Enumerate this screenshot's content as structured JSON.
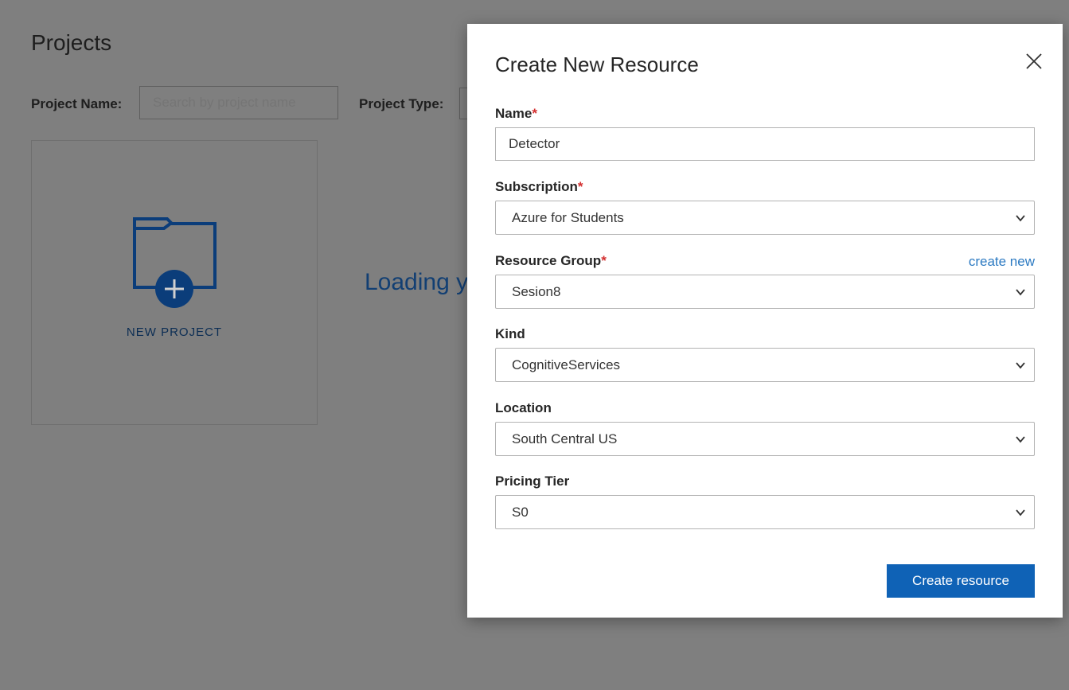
{
  "background": {
    "page_title": "Projects",
    "filters": {
      "project_name_label": "Project Name:",
      "search_placeholder": "Search by project name",
      "project_type_label": "Project Type:"
    },
    "new_project_label": "NEW PROJECT",
    "loading_text": "Loading your projects..."
  },
  "modal": {
    "title": "Create New Resource",
    "fields": {
      "name": {
        "label": "Name",
        "required_mark": "*",
        "value": "Detector"
      },
      "subscription": {
        "label": "Subscription",
        "required_mark": "*",
        "value": "Azure for Students"
      },
      "resource_group": {
        "label": "Resource Group",
        "required_mark": "*",
        "value": "Sesion8",
        "create_new_label": "create new"
      },
      "kind": {
        "label": "Kind",
        "value": "CognitiveServices"
      },
      "location": {
        "label": "Location",
        "value": "South Central US"
      },
      "pricing_tier": {
        "label": "Pricing Tier",
        "value": "S0"
      }
    },
    "submit_label": "Create resource"
  },
  "colors": {
    "overlay": "#7f7f7f",
    "primary_button": "#0f62b6",
    "link": "#2c7ac2",
    "required": "#d32f2f",
    "icon_blue": "#0b3d7a"
  }
}
